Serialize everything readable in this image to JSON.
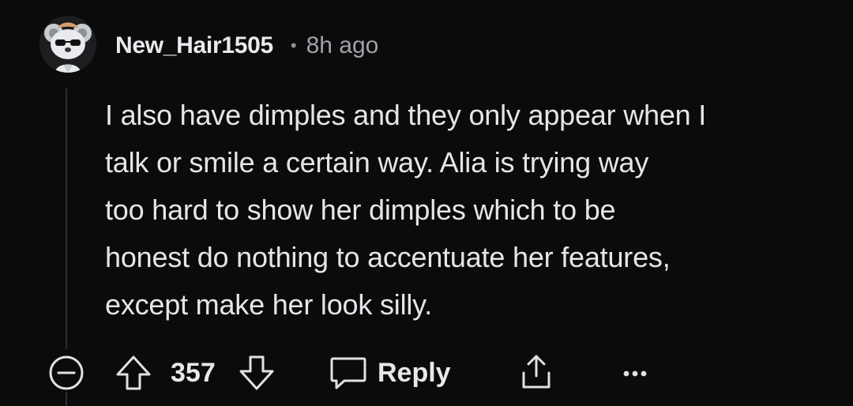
{
  "comment": {
    "author": "New_Hair1505",
    "separator": "•",
    "timestamp": "8h ago",
    "body_lines": [
      "I also have dimples and they only appear when I",
      "talk or smile a certain way. Alia is trying way",
      "too hard to show her dimples which to be",
      "honest do nothing to accentuate her features,",
      "except make her look silly."
    ],
    "votes": "357",
    "reply_label": "Reply"
  },
  "icons": {
    "collapse": "collapse-minus-icon",
    "upvote": "upvote-arrow-icon",
    "downvote": "downvote-arrow-icon",
    "reply": "speech-bubble-icon",
    "share": "share-icon",
    "more": "more-dots-icon"
  },
  "colors": {
    "background": "#0b0b0c",
    "text": "#e6e8ea",
    "muted": "#9ea3a8",
    "thread_line": "#2b2e31"
  }
}
